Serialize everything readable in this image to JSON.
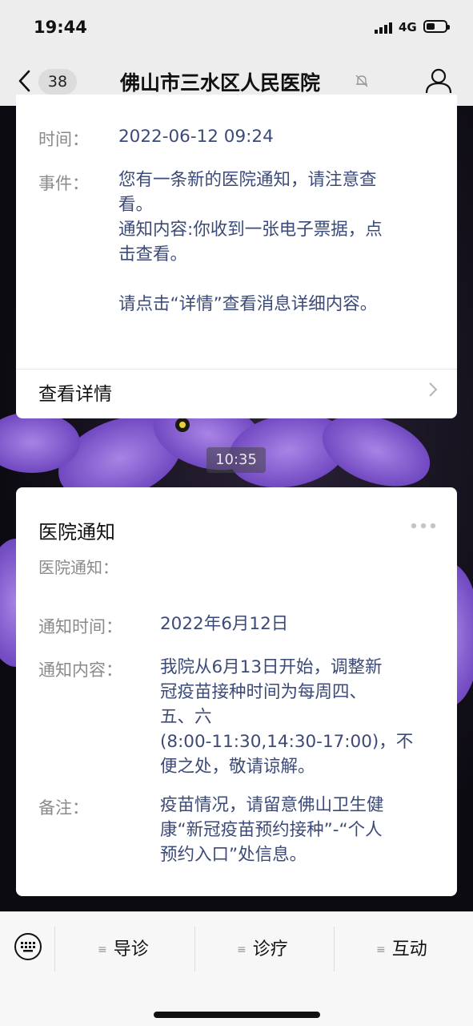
{
  "status_bar": {
    "time": "19:44",
    "network": "4G"
  },
  "nav": {
    "unread_count": "38",
    "title": "佛山市三水区人民医院"
  },
  "card1": {
    "rows": [
      {
        "label": "时间：",
        "value": "2022-06-12 09:24"
      },
      {
        "label": "事件：",
        "lines": [
          "您有一条新的医院通知，请注意查",
          "看。",
          "通知内容:你收到一张电子票据，点",
          "击查看。",
          "",
          "请点击“详情”查看消息详细内容。"
        ]
      }
    ],
    "detail_link": "查看详情"
  },
  "timestamp": "10:35",
  "card2": {
    "title": "医院通知",
    "subtitle": "医院通知：",
    "rows": [
      {
        "label": "通知时间：",
        "lines": [
          "2022年6月12日"
        ]
      },
      {
        "label": "通知内容：",
        "lines": [
          "我院从6月13日开始，调整新",
          "冠疫苗接种时间为每周四、",
          "五、六",
          "(8:00-11:30,14:30-17:00)，不",
          "便之处，敬请谅解。"
        ]
      },
      {
        "label": "备注：",
        "lines": [
          "疫苗情况，请留意佛山卫生健",
          "康“新冠疫苗预约接种”-“个人",
          "预约入口”处信息。"
        ]
      }
    ]
  },
  "bottom_menu": {
    "items": [
      "导诊",
      "诊疗",
      "互动"
    ]
  },
  "colors": {
    "value_text": "#3b4a78",
    "label_text": "#8a8a8a",
    "flower": "#8a5fd6"
  }
}
